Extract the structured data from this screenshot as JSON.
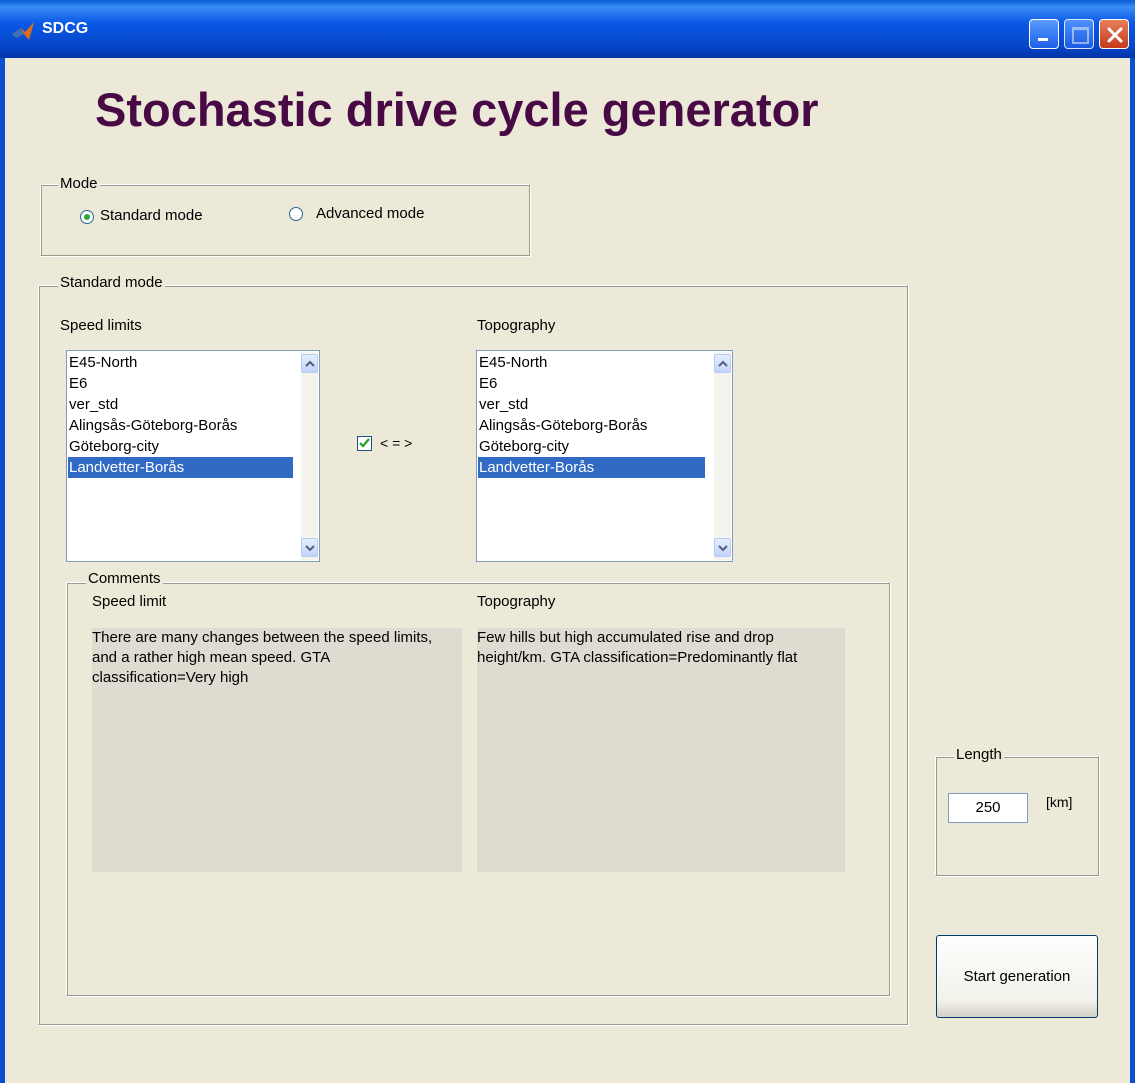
{
  "window": {
    "title": "SDCG"
  },
  "app_title": "Stochastic drive cycle generator",
  "mode_group": {
    "label": "Mode",
    "options": [
      "Standard mode",
      "Advanced mode"
    ],
    "selected": "Standard mode"
  },
  "standard_group": {
    "label": "Standard mode"
  },
  "speed_limits": {
    "label": "Speed limits",
    "items": [
      "E45-North",
      "E6",
      "ver_std",
      "Alingsås-Göteborg-Borås",
      "Göteborg-city",
      "Landvetter-Borås"
    ],
    "selected": "Landvetter-Borås"
  },
  "topography": {
    "label": "Topography",
    "items": [
      "E45-North",
      "E6",
      "ver_std",
      "Alingsås-Göteborg-Borås",
      "Göteborg-city",
      "Landvetter-Borås"
    ],
    "selected": "Landvetter-Borås"
  },
  "link_checkbox": {
    "label": "< = >",
    "checked": true
  },
  "comments": {
    "label": "Comments",
    "speed_heading": "Speed limit",
    "speed_text": "There are many changes between the speed limits, and a rather high mean speed. GTA classification=Very high",
    "topo_heading": "Topography",
    "topo_text": "Few hills but high accumulated rise and drop height/km. GTA classification=Predominantly flat"
  },
  "length_group": {
    "label": "Length",
    "value": "250",
    "unit": "[km]"
  },
  "start_button": {
    "label": "Start generation"
  },
  "colors": {
    "title": "#470a45",
    "window_bg": "#ece9d8",
    "selection": "#316ac5"
  }
}
